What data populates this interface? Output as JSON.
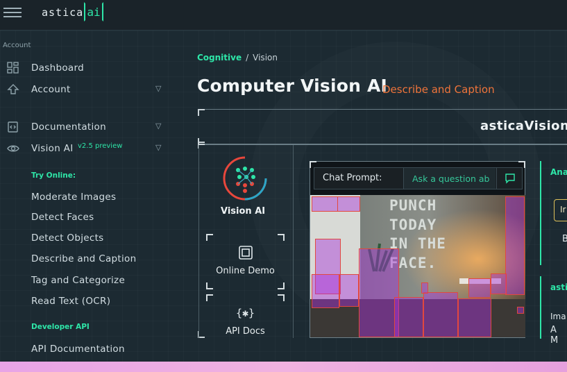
{
  "app": {
    "logo_text": "astica",
    "logo_badge": "ai"
  },
  "sidebar": {
    "section_label": "Account",
    "items": [
      {
        "label": "Dashboard",
        "icon": "grid-icon"
      },
      {
        "label": "Account",
        "icon": "upload-icon"
      },
      {
        "label": "Documentation",
        "icon": "code-doc-icon"
      },
      {
        "label": "Vision AI",
        "icon": "eye-icon",
        "badge": "v2.5 preview"
      }
    ],
    "try_online_label": "Try Online:",
    "try_online": [
      "Moderate Images",
      "Detect Faces",
      "Detect Objects",
      "Describe and Caption",
      "Tag and Categorize",
      "Read Text (OCR)"
    ],
    "developer_label": "Developer API",
    "developer": [
      "API Documentation"
    ]
  },
  "breadcrumb": {
    "parent": "Cognitive",
    "separator": "/",
    "current": "Vision"
  },
  "page": {
    "title": "Computer Vision AI",
    "subtitle": "Describe and Caption"
  },
  "panel": {
    "brand": "asticaVision",
    "product_label": "Vision AI",
    "online_demo": "Online Demo",
    "api_docs": "API Docs"
  },
  "chat": {
    "label": "Chat Prompt:",
    "placeholder": "Ask a question ab"
  },
  "photo": {
    "wall_text": [
      "PUNCH",
      "TODAY",
      "IN THE",
      "FACE."
    ]
  },
  "right_cards": [
    {
      "title": "Ana",
      "button": "Ir",
      "letter": "B"
    },
    {
      "title": "asti",
      "line1": "Ima",
      "line2": "A M"
    }
  ],
  "colors": {
    "accent": "#2ee6a8",
    "orange": "#f0743a",
    "bbox": "#e2483f"
  }
}
